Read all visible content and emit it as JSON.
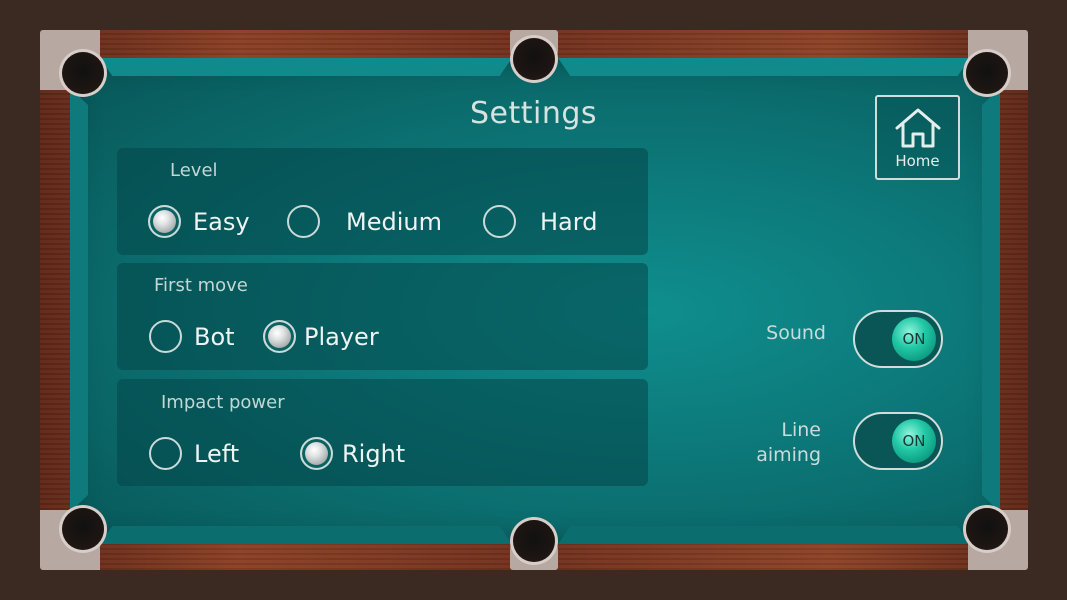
{
  "title": "Settings",
  "home": {
    "label": "Home",
    "icon": "home-icon"
  },
  "level": {
    "label": "Level",
    "options": [
      {
        "label": "Easy",
        "selected": true
      },
      {
        "label": "Medium",
        "selected": false
      },
      {
        "label": "Hard",
        "selected": false
      }
    ]
  },
  "first_move": {
    "label": "First move",
    "options": [
      {
        "label": "Bot",
        "selected": false
      },
      {
        "label": "Player",
        "selected": true
      }
    ]
  },
  "impact_power": {
    "label": "Impact power",
    "options": [
      {
        "label": "Left",
        "selected": false
      },
      {
        "label": "Right",
        "selected": true
      }
    ]
  },
  "sound": {
    "label": "Sound",
    "state": "ON",
    "on": true
  },
  "line_aiming": {
    "label_line1": "Line",
    "label_line2": "aiming",
    "state": "ON",
    "on": true
  },
  "colors": {
    "felt": "#0d7b7c",
    "wood": "#8a3f24",
    "toggle_on": "#22c8a6"
  }
}
